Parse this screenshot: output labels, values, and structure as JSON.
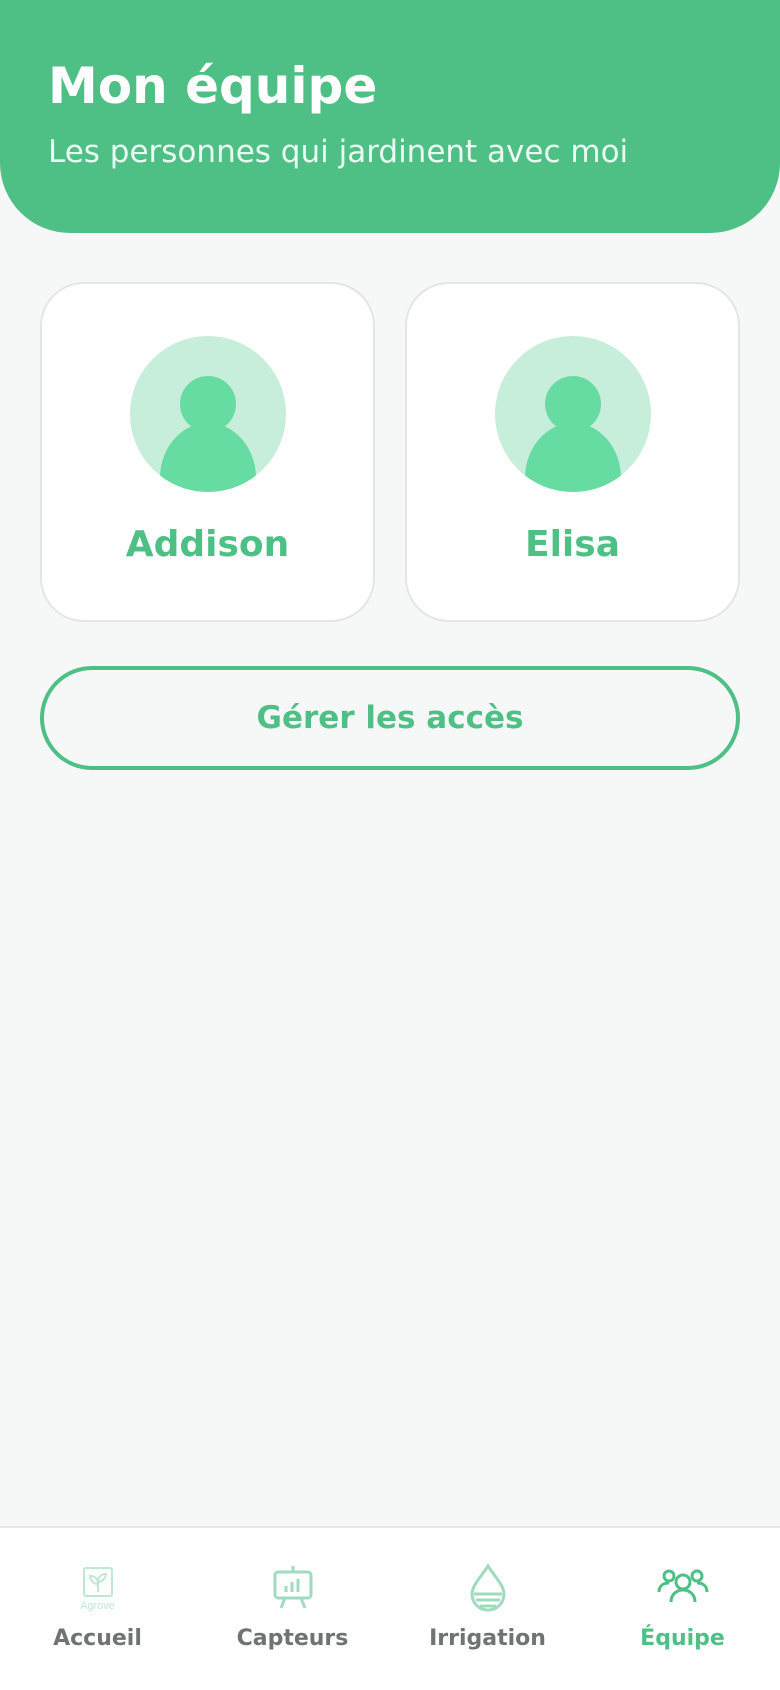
{
  "header": {
    "title": "Mon équipe",
    "subtitle": "Les personnes qui jardinent avec moi"
  },
  "members": [
    {
      "name": "Addison",
      "avatar_icon": "user-avatar-icon"
    },
    {
      "name": "Elisa",
      "avatar_icon": "user-avatar-icon"
    }
  ],
  "actions": {
    "manage_access_label": "Gérer les accès"
  },
  "nav": {
    "items": [
      {
        "label": "Accueil",
        "icon": "agrove-logo-icon",
        "logo_text": "Agrove"
      },
      {
        "label": "Capteurs",
        "icon": "sensor-chart-icon"
      },
      {
        "label": "Irrigation",
        "icon": "water-drop-icon"
      },
      {
        "label": "Équipe",
        "icon": "team-icon",
        "active": true
      }
    ]
  },
  "colors": {
    "primary": "#4ebf85",
    "avatar_bg": "#c7eddb",
    "avatar_figure": "#66dba2",
    "nav_inactive": "#6f7473",
    "nav_icon_inactive": "#b9e5cf"
  }
}
